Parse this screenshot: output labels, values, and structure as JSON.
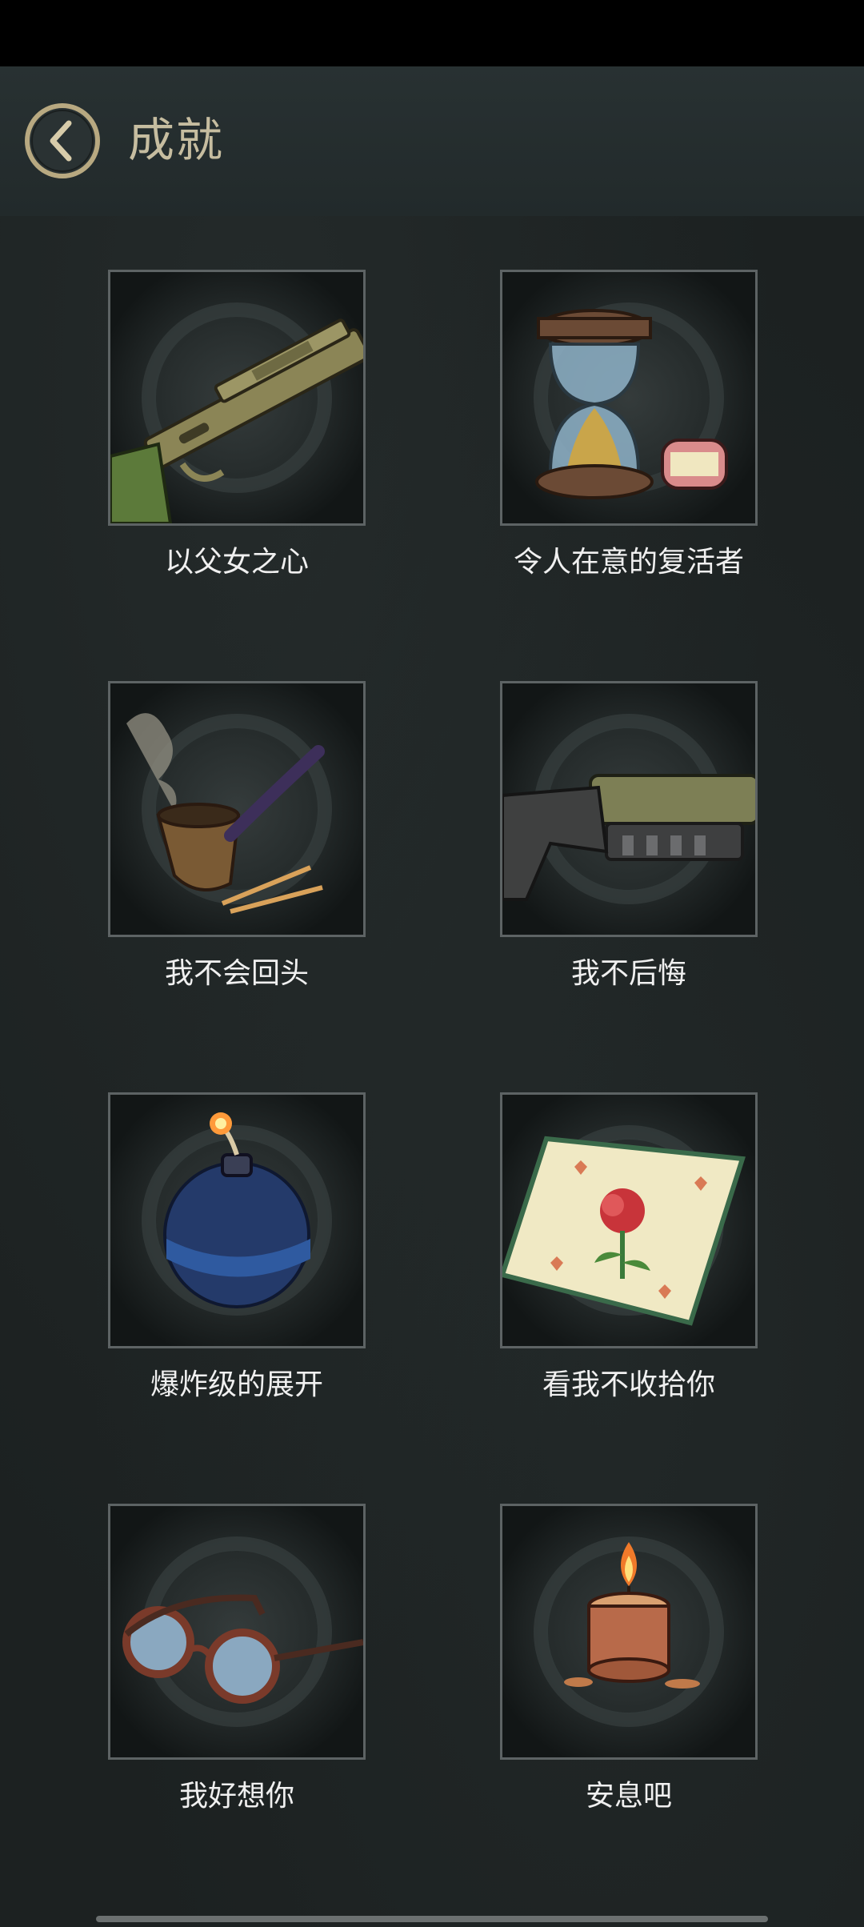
{
  "header": {
    "title": "成就",
    "back_icon": "chevron-left-icon"
  },
  "achievements": [
    {
      "label": "以父女之心",
      "icon": "shotgun-icon"
    },
    {
      "label": "令人在意的复活者",
      "icon": "hourglass-dentures-icon"
    },
    {
      "label": "我不会回头",
      "icon": "pipe-matches-icon"
    },
    {
      "label": "我不后悔",
      "icon": "nail-gun-icon"
    },
    {
      "label": "爆炸级的展开",
      "icon": "bomb-icon"
    },
    {
      "label": "看我不收拾你",
      "icon": "rose-handkerchief-icon"
    },
    {
      "label": "我好想你",
      "icon": "glasses-icon"
    },
    {
      "label": "安息吧",
      "icon": "candle-icon"
    }
  ],
  "colors": {
    "accent": "#c6bda0",
    "frame_border": "#5d6364",
    "background": "#1c2121"
  }
}
